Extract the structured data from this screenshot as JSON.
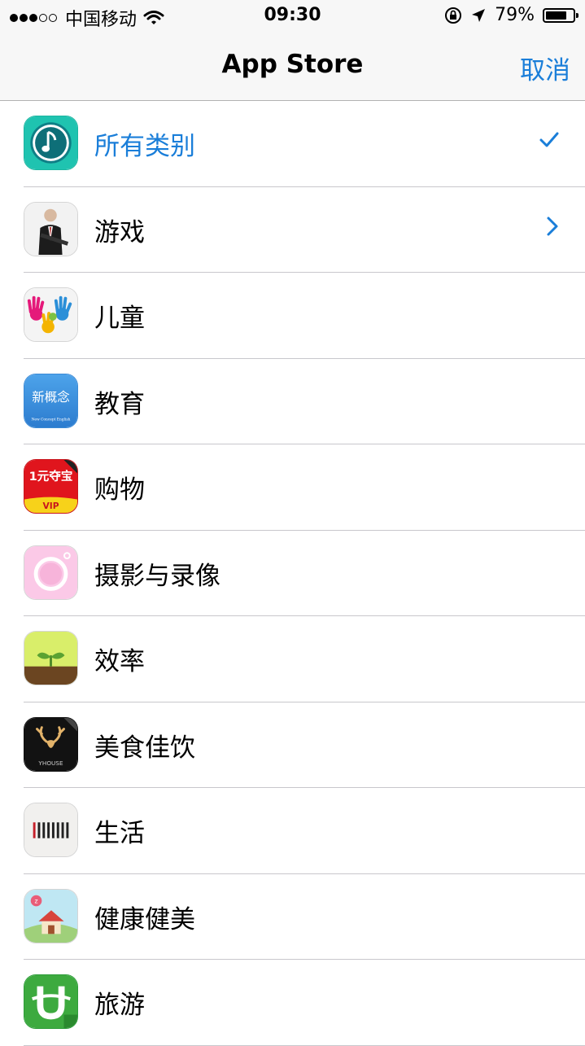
{
  "status_bar": {
    "carrier": "中国移动",
    "time": "09:30",
    "battery_percent_text": "79%",
    "battery_level": 0.79,
    "signal_bars_filled": 3,
    "signal_bars_total": 5,
    "icons": [
      "wifi-icon",
      "orientation-lock-icon",
      "location-icon",
      "battery-icon"
    ]
  },
  "nav": {
    "title": "App Store",
    "cancel_label": "取消"
  },
  "categories": [
    {
      "label": "所有类别",
      "icon": "music-app-icon",
      "selected": true
    },
    {
      "label": "游戏",
      "icon": "hitman-game-icon",
      "has_submenu": true
    },
    {
      "label": "儿童",
      "icon": "colorful-hands-icon"
    },
    {
      "label": "教育",
      "icon": "new-concept-english-icon",
      "icon_text": "新概念",
      "icon_subtext": "New Concept English"
    },
    {
      "label": "购物",
      "icon": "shopping-vip-icon",
      "icon_text": "1元夺宝",
      "icon_badge": "VIP"
    },
    {
      "label": "摄影与录像",
      "icon": "pink-camera-icon"
    },
    {
      "label": "效率",
      "icon": "sprout-icon"
    },
    {
      "label": "美食佳饮",
      "icon": "yhouse-deer-icon",
      "icon_text": "YHOUSE"
    },
    {
      "label": "生活",
      "icon": "barcode-icon"
    },
    {
      "label": "健康健美",
      "icon": "sleep-house-icon"
    },
    {
      "label": "旅游",
      "icon": "green-u-icon"
    }
  ],
  "colors": {
    "accent": "#1a7ed9",
    "bar_background": "#f7f7f7",
    "separator": "#c8c7cc"
  }
}
